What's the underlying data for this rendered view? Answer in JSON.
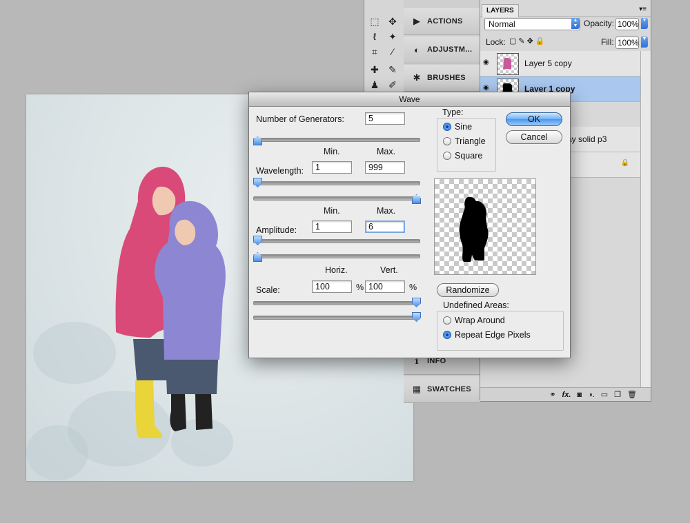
{
  "dock": {
    "items": [
      {
        "icon": "actions-icon",
        "label": "ACTIONS"
      },
      {
        "icon": "adjustments-icon",
        "label": "ADJUSTM..."
      },
      {
        "icon": "brushes-icon",
        "label": "BRUSHES"
      },
      {
        "icon": "info-icon",
        "label": "INFO"
      },
      {
        "icon": "swatches-icon",
        "label": "SWATCHES"
      }
    ]
  },
  "layers": {
    "tab_label": "LAYERS",
    "blend_mode": "Normal",
    "opacity_label": "Opacity:",
    "opacity_value": "100%",
    "lock_label": "Lock:",
    "fill_label": "Fill:",
    "fill_value": "100%",
    "rows": [
      {
        "name": "Layer 5 copy"
      },
      {
        "name": "Layer 1 copy"
      },
      {
        "name": "ay solid p3"
      }
    ]
  },
  "wave": {
    "title": "Wave",
    "generators_label": "Number of Generators:",
    "generators_value": "5",
    "min_label": "Min.",
    "max_label": "Max.",
    "wavelength_label": "Wavelength:",
    "wavelength_min": "1",
    "wavelength_max": "999",
    "amplitude_label": "Amplitude:",
    "amplitude_min": "1",
    "amplitude_max": "6",
    "horiz_label": "Horiz.",
    "vert_label": "Vert.",
    "scale_label": "Scale:",
    "scale_horiz": "100",
    "scale_vert": "100",
    "percent": "%",
    "type_label": "Type:",
    "types": [
      "Sine",
      "Triangle",
      "Square"
    ],
    "selected_type": "Sine",
    "ok_label": "OK",
    "cancel_label": "Cancel",
    "randomize_label": "Randomize",
    "undefined_label": "Undefined Areas:",
    "undefined_options": [
      "Wrap Around",
      "Repeat Edge Pixels"
    ],
    "selected_undefined": "Repeat Edge Pixels"
  }
}
